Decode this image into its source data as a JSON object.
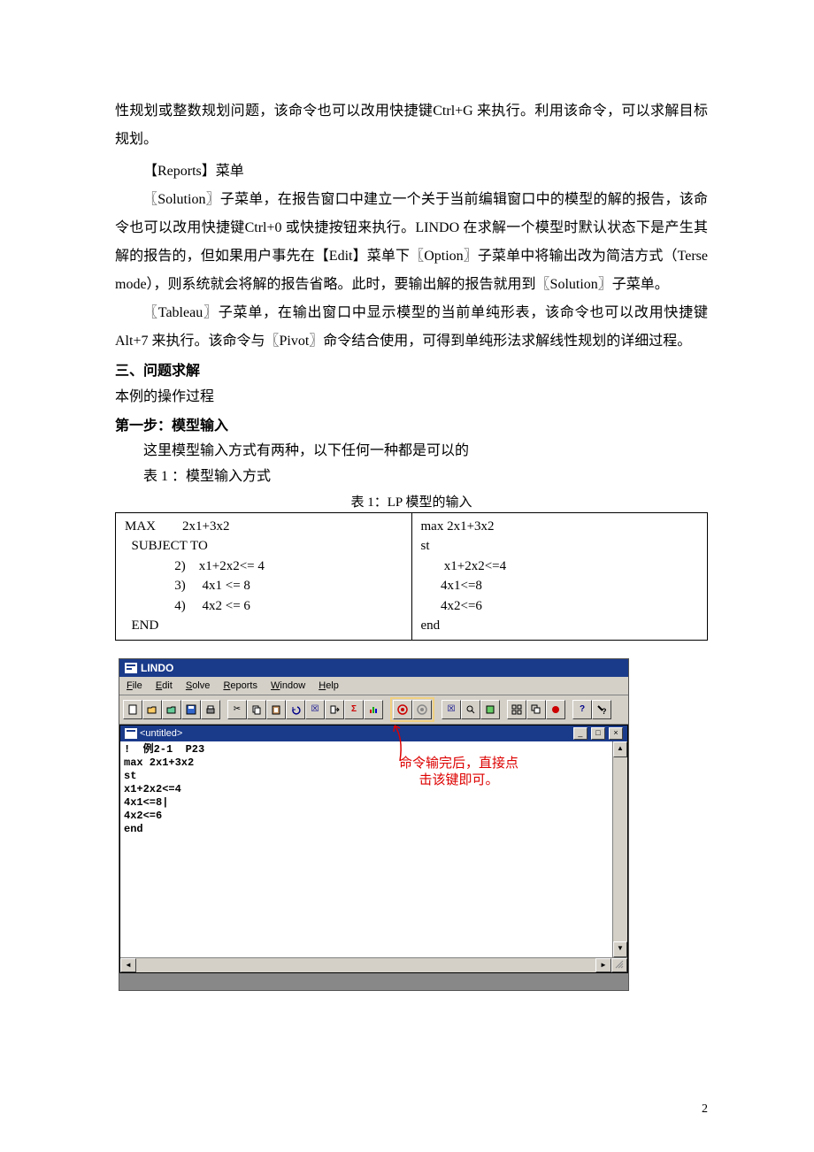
{
  "paragraphs": {
    "p1": "性规划或整数规划问题，该命令也可以改用快捷键Ctrl+G 来执行。利用该命令，可以求解目标规划。",
    "p2": "【Reports】菜单",
    "p3": "〖Solution〗子菜单，在报告窗口中建立一个关于当前编辑窗口中的模型的解的报告，该命令也可以改用快捷键Ctrl+0 或快捷按钮来执行。LINDO 在求解一个模型时默认状态下是产生其解的报告的，但如果用户事先在【Edit】菜单下〖Option〗子菜单中将输出改为简洁方式（Terse mode），则系统就会将解的报告省略。此时，要输出解的报告就用到〖Solution〗子菜单。",
    "p4": "〖Tableau〗子菜单，在输出窗口中显示模型的当前单纯形表，该命令也可以改用快捷键Alt+7 来执行。该命令与〖Pivot〗命令结合使用，可得到单纯形法求解线性规划的详细过程。"
  },
  "section3": "三、问题求解",
  "procLine": "本例的操作过程",
  "step1": "第一步：模型输入",
  "step1desc": "这里模型输入方式有两种，以下任何一种都是可以的",
  "tableIntro": "表 1 ：模型输入方式",
  "tableCaption": "表 1：LP 模型的输入",
  "table": {
    "left": "MAX        2x1+3x2\n  SUBJECT TO\n               2)    x1+2x2<= 4\n               3)     4x1 <= 8\n               4)     4x2 <= 6\n  END",
    "right": "max 2x1+3x2\nst\n       x1+2x2<=4\n      4x1<=8\n      4x2<=6\nend"
  },
  "app": {
    "title": "LINDO",
    "menus": [
      "File",
      "Edit",
      "Solve",
      "Reports",
      "Window",
      "Help"
    ],
    "childTitle": "<untitled>",
    "code": "!  例2-1  P23\nmax 2x1+3x2\nst\nx1+2x2<=4\n4x1<=8|\n4x2<=6\nend",
    "annotation": "命令输完后，直接点\n击该键即可。"
  },
  "pageNumber": "2"
}
